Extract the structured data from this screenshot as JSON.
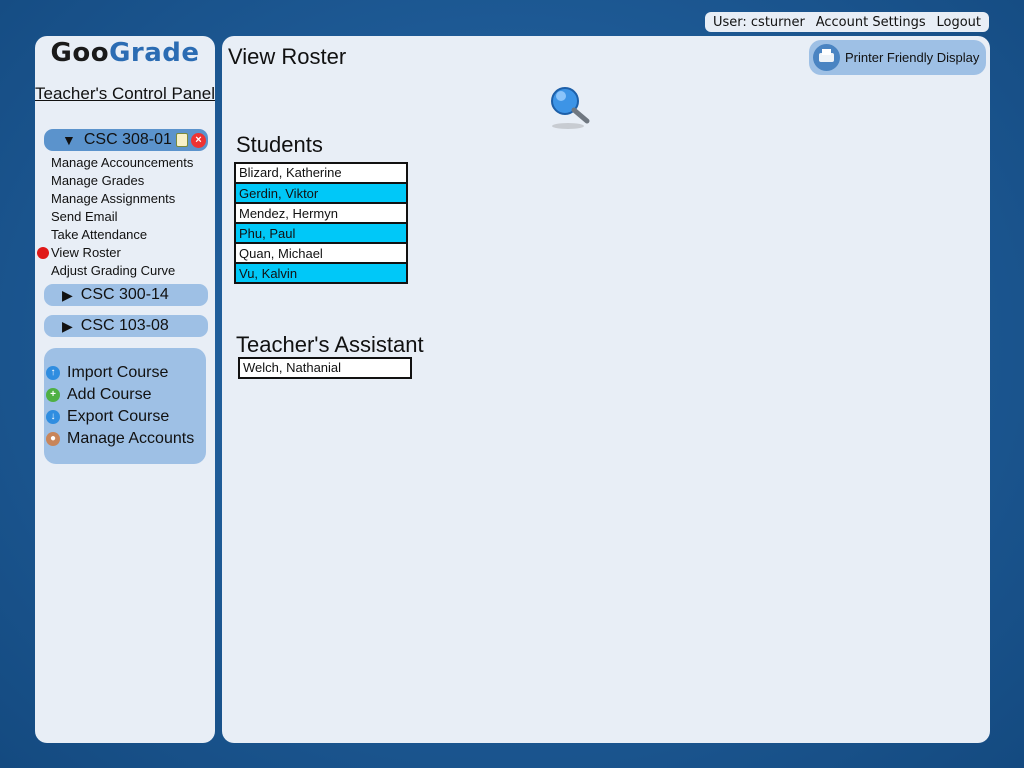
{
  "topbar": {
    "user_label": "User: csturner",
    "account_settings": "Account Settings",
    "logout": "Logout"
  },
  "sidebar": {
    "logo_goo": "Goo",
    "logo_grade": "Grade",
    "panel_title": "Teacher's Control Panel",
    "active_course": {
      "arrow": "▼",
      "name": "CSC 308-01",
      "menu": [
        {
          "label": "Manage Accouncements",
          "selected": false
        },
        {
          "label": "Manage Grades",
          "selected": false
        },
        {
          "label": "Manage Assignments",
          "selected": false
        },
        {
          "label": "Send Email",
          "selected": false
        },
        {
          "label": "Take Attendance",
          "selected": false
        },
        {
          "label": "View Roster",
          "selected": true
        },
        {
          "label": "Adjust Grading Curve",
          "selected": false
        }
      ]
    },
    "collapsed_courses": [
      {
        "arrow": "▶",
        "name": "CSC 300-14"
      },
      {
        "arrow": "▶",
        "name": "CSC 103-08"
      }
    ],
    "actions": [
      {
        "label": "Import Course",
        "icon": "import-icon"
      },
      {
        "label": "Add Course",
        "icon": "add-icon"
      },
      {
        "label": "Export Course",
        "icon": "export-icon"
      },
      {
        "label": "Manage Accounts",
        "icon": "user-icon"
      }
    ]
  },
  "main": {
    "title": "View Roster",
    "print_button": "Printer Friendly Display",
    "students_heading": "Students",
    "students": [
      "Blizard, Katherine",
      "Gerdin, Viktor",
      "Mendez, Hermyn",
      "Phu, Paul",
      "Quan, Michael",
      "Vu, Kalvin"
    ],
    "ta_heading": "Teacher's Assistant",
    "teaching_assistant": "Welch, Nathanial"
  },
  "colors": {
    "background": "#1f5c98",
    "panel": "#e8eef6",
    "active_course": "#5b93cc",
    "light_blue": "#9ec0e5",
    "row_highlight": "#00c8f8",
    "selected_dot": "#e01818"
  }
}
